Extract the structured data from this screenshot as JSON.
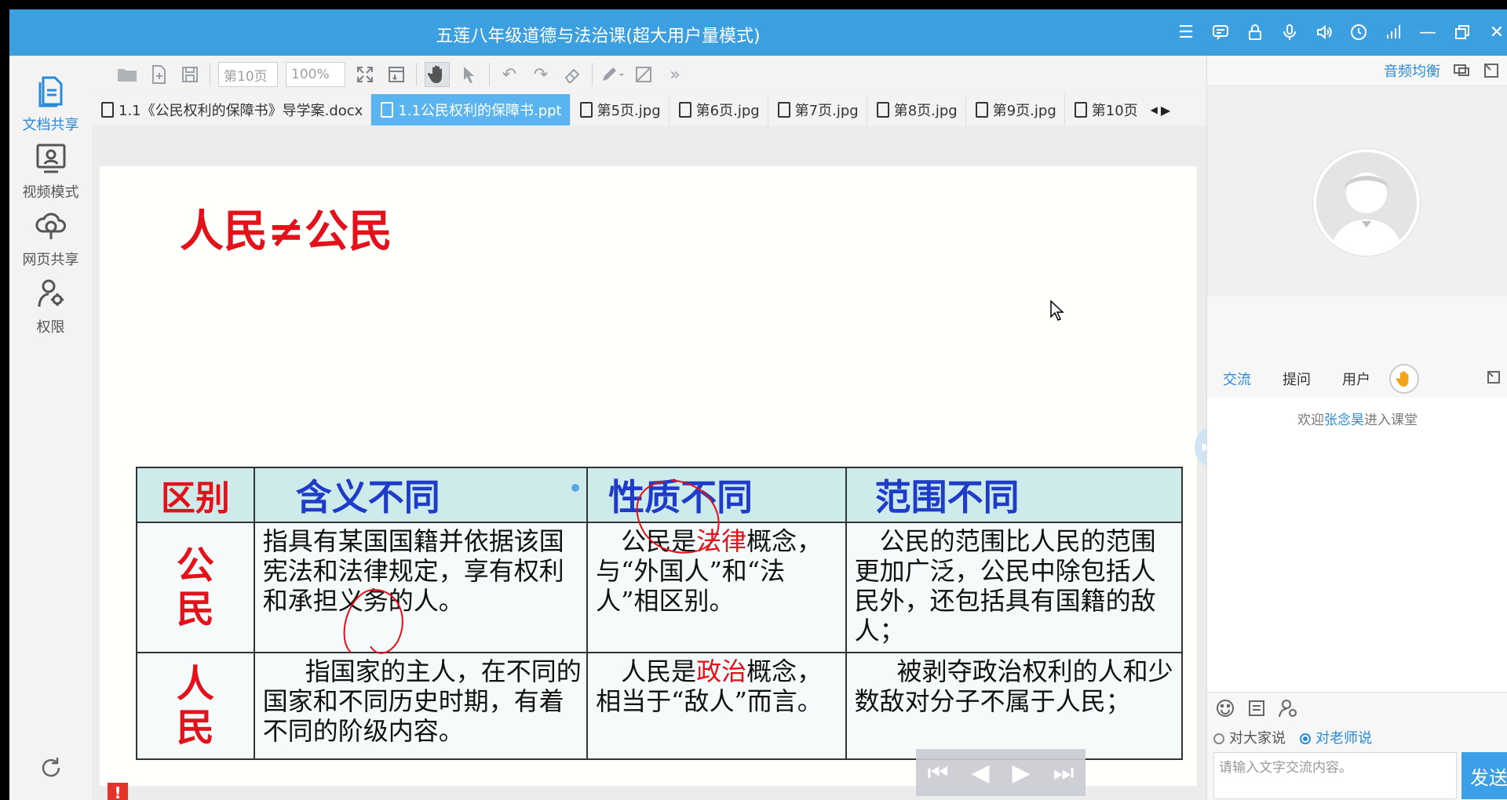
{
  "window": {
    "title": "五莲八年级道德与法治课(超大用户量模式)",
    "controls": [
      "menu-icon",
      "message-icon",
      "lock-icon",
      "mic-icon",
      "speaker-icon",
      "clock-icon",
      "signal-icon",
      "minimize-icon",
      "restore-icon",
      "close-icon"
    ]
  },
  "sidebar": {
    "items": [
      {
        "label": "文档共享",
        "icon": "document-icon",
        "active": true
      },
      {
        "label": "视频模式",
        "icon": "video-mode-icon",
        "active": false
      },
      {
        "label": "网页共享",
        "icon": "web-share-icon",
        "active": false
      },
      {
        "label": "权限",
        "icon": "permission-icon",
        "active": false
      }
    ]
  },
  "toolbar": {
    "page_select": "第10页",
    "zoom_select": "100%"
  },
  "tabs": [
    {
      "label": "1.1《公民权利的保障书》导学案.docx",
      "active": false
    },
    {
      "label": "1.1公民权利的保障书.ppt",
      "active": true
    },
    {
      "label": "第5页.jpg",
      "active": false
    },
    {
      "label": "第6页.jpg",
      "active": false
    },
    {
      "label": "第7页.jpg",
      "active": false
    },
    {
      "label": "第8页.jpg",
      "active": false
    },
    {
      "label": "第9页.jpg",
      "active": false
    },
    {
      "label": "第10页",
      "active": false
    }
  ],
  "tab_scroll": {
    "left": "◀",
    "right": "▶"
  },
  "slide": {
    "title": "人民≠公民",
    "table": {
      "headers": [
        "区别",
        "含义不同",
        "性质不同",
        "范围不同"
      ],
      "rows": [
        {
          "label": "公民",
          "meaning": "指具有某国国籍并依据该国宪法和法律规定，享有权利和承担义务的人。",
          "nature_pre": "公民是",
          "nature_hl": "法律",
          "nature_post": "概念，与“外国人”和“法人”相区别。",
          "scope": "公民的范围比人民的范围更加广泛，公民中除包括人民外，还包括具有国籍的敌人；"
        },
        {
          "label": "人民",
          "meaning": "指国家的主人，在不同的国家和不同历史时期，有着不同的阶级内容。",
          "nature_pre": "人民是",
          "nature_hl": "政治",
          "nature_post": "概念，相当于“敌人”而言。",
          "scope": "被剥夺政治权利的人和少数敌对分子不属于人民；"
        }
      ]
    }
  },
  "player_nav": [
    "first-page-icon",
    "prev-page-icon",
    "next-page-icon",
    "last-page-icon"
  ],
  "right_panel": {
    "top_label": "音频均衡",
    "chat_tabs": [
      {
        "label": "交流",
        "active": true
      },
      {
        "label": "提问",
        "active": false
      },
      {
        "label": "用户",
        "active": false
      }
    ],
    "welcome_pre": "欢迎",
    "welcome_name": "张念昊",
    "welcome_post": "进入课堂",
    "target_all": "对大家说",
    "target_teacher": "对老师说",
    "target_selected": "对老师说",
    "input_placeholder": "请输入文字交流内容。",
    "send_label": "发送"
  },
  "colors": {
    "titlebar": "#3c9fe0",
    "accent": "#2a8ad8",
    "slide_red": "#e4101a",
    "slide_blue": "#1e3cc8",
    "table_header_bg": "#cdebeb"
  }
}
